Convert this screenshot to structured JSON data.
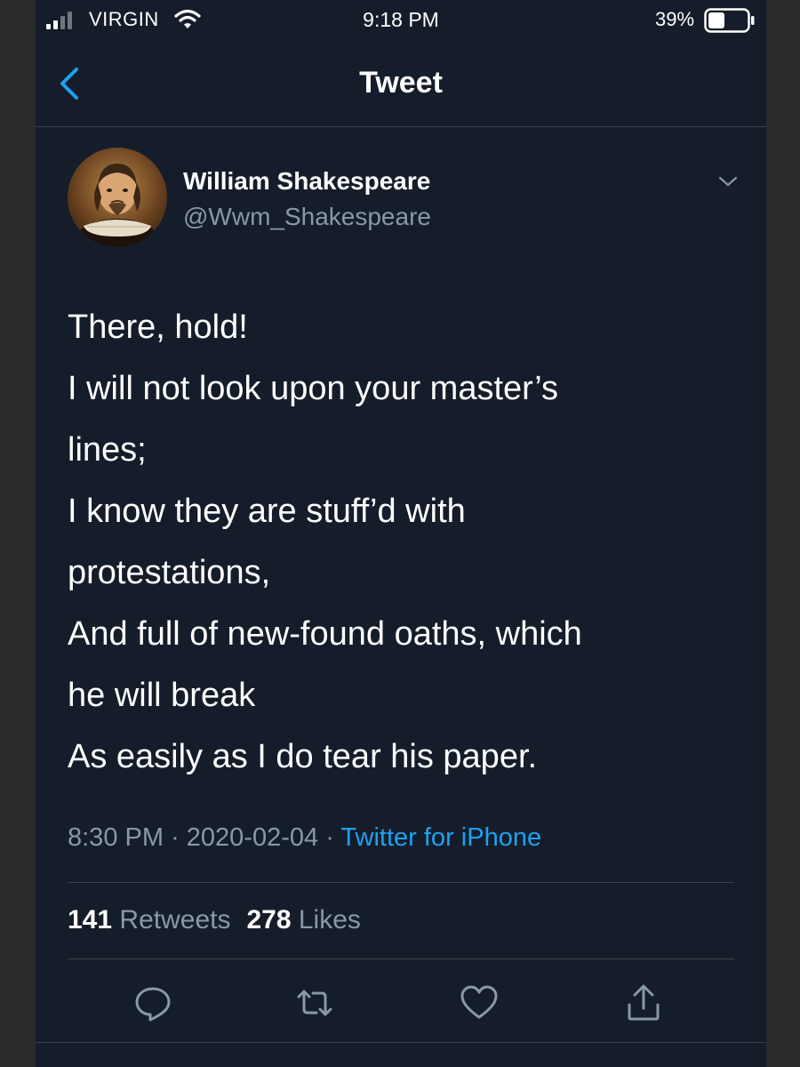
{
  "status_bar": {
    "carrier": "VIRGIN",
    "time": "9:18 PM",
    "battery": "39%"
  },
  "header": {
    "title": "Tweet"
  },
  "tweet": {
    "author": {
      "name": "William Shakespeare",
      "handle": "@Wwm_Shakespeare"
    },
    "lines": [
      "There, hold!",
      "I will not look upon your master’s",
      "lines;",
      "I know they are stuff’d with",
      "protestations,",
      "And full of new-found oaths, which",
      "he will break",
      "As easily as I do tear his paper."
    ],
    "time": "8:30 PM",
    "separator": "·",
    "date": "2020-02-04",
    "source": "Twitter for iPhone",
    "retweets_count": "141",
    "retweets_label": "Retweets",
    "likes_count": "278",
    "likes_label": "Likes"
  },
  "icons": {
    "back": "chevron-left-icon",
    "menu": "chevron-down-icon",
    "reply": "speech-bubble-icon",
    "retweet": "retweet-arrows-icon",
    "like": "heart-icon",
    "share": "share-arrow-icon"
  },
  "colors": {
    "background": "#151d2a",
    "accent": "#1da1f2",
    "secondary_text": "#8899a6",
    "divider": "#38444d"
  }
}
